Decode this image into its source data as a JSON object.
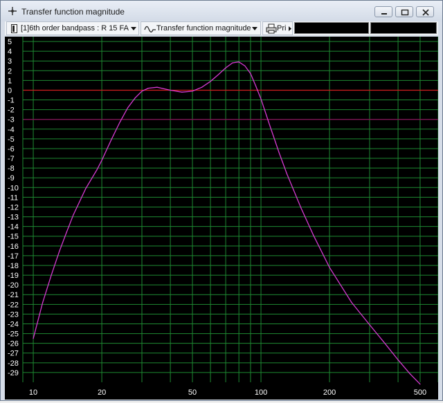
{
  "window": {
    "title": "Transfer function magnitude",
    "icon": "crosshair-icon"
  },
  "toolbar": {
    "project_label": "[1]6th order bandpass : R 15 FA",
    "view_label": "Transfer function magnitude",
    "print_label": "Pri"
  },
  "colors": {
    "grid": "#1e8a32",
    "zero_line": "#d21e1e",
    "minus3_line": "#8a0c5a",
    "curve": "#d63ad2",
    "axis_text": "#ffffff",
    "background": "#000000"
  },
  "chart_data": {
    "type": "line",
    "title": "",
    "xlabel": "",
    "ylabel": "",
    "x_scale": "log",
    "xlim": [
      9,
      600
    ],
    "ylim": [
      -30,
      5.5
    ],
    "x_ticks": [
      10,
      20,
      50,
      100,
      200,
      500
    ],
    "x_tick_labels": [
      "10",
      "20",
      "50",
      "100",
      "200",
      "500"
    ],
    "y_ticks": [
      5,
      4,
      3,
      2,
      1,
      0,
      -1,
      -2,
      -3,
      -4,
      -5,
      -6,
      -7,
      -8,
      -9,
      -10,
      -11,
      -12,
      -13,
      -14,
      -15,
      -16,
      -17,
      -18,
      -19,
      -20,
      -21,
      -22,
      -23,
      -24,
      -25,
      -26,
      -27,
      -28,
      -29
    ],
    "grid": true,
    "reference_lines": [
      {
        "y": 0,
        "role": "zero_line"
      },
      {
        "y": -3,
        "role": "minus3_line"
      }
    ],
    "series": [
      {
        "x": [
          10,
          11,
          12,
          13,
          14,
          15,
          17,
          19,
          20,
          22,
          24,
          26,
          28,
          30,
          32,
          35,
          40,
          45,
          50,
          55,
          60,
          65,
          70,
          75,
          80,
          85,
          90,
          95,
          100,
          110,
          120,
          130,
          150,
          170,
          200,
          250,
          300,
          350,
          400,
          450,
          500
        ],
        "y": [
          -25.5,
          -21.8,
          -19.0,
          -16.6,
          -14.6,
          -12.8,
          -10.1,
          -8.2,
          -7.2,
          -5.1,
          -3.3,
          -1.8,
          -0.8,
          -0.1,
          0.2,
          0.3,
          0.0,
          -0.2,
          -0.1,
          0.3,
          0.9,
          1.6,
          2.3,
          2.8,
          2.9,
          2.5,
          1.7,
          0.4,
          -0.9,
          -3.8,
          -6.4,
          -8.6,
          -12.1,
          -14.9,
          -18.2,
          -21.8,
          -24.1,
          -26.0,
          -27.7,
          -29.1,
          -30.2
        ]
      }
    ]
  }
}
